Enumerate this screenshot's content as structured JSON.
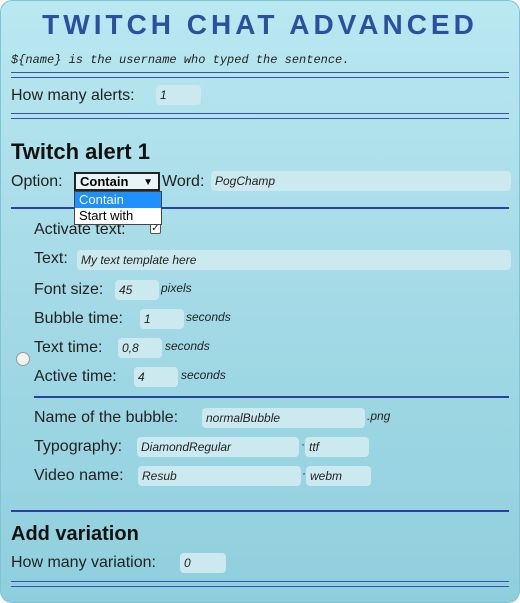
{
  "title": "TWITCH CHAT ADVANCED",
  "hint": "${name} is the username who typed the sentence.",
  "alerts": {
    "label": "How many alerts:",
    "value": "1"
  },
  "alert1": {
    "heading": "Twitch alert 1",
    "option_label": "Option:",
    "option_selected": "Contain",
    "option_choices": [
      "Contain",
      "Start with"
    ],
    "word_label": "Word:",
    "word_value": "PogChamp",
    "activate_label": "Activate text:",
    "activate_checked": true,
    "text_label": "Text:",
    "text_placeholder": "My text template here",
    "font_size_label": "Font size:",
    "font_size_value": "45",
    "font_size_unit": "pixels",
    "bubble_time_label": "Bubble time:",
    "bubble_time_value": "1",
    "bubble_time_unit": "seconds",
    "text_time_label": "Text time:",
    "text_time_value": "0,8",
    "text_time_unit": "seconds",
    "active_time_label": "Active time:",
    "active_time_value": "4",
    "active_time_unit": "seconds",
    "bubble_name_label": "Name of the bubble:",
    "bubble_name_value": "normalBubble",
    "bubble_ext": ".png",
    "typography_label": "Typography:",
    "typography_value": "DiamondRegular",
    "typography_ext": "ttf",
    "video_label": "Video name:",
    "video_value": "Resub",
    "video_ext": "webm"
  },
  "variation": {
    "heading": "Add variation",
    "label": "How many variation:",
    "value": "0"
  }
}
